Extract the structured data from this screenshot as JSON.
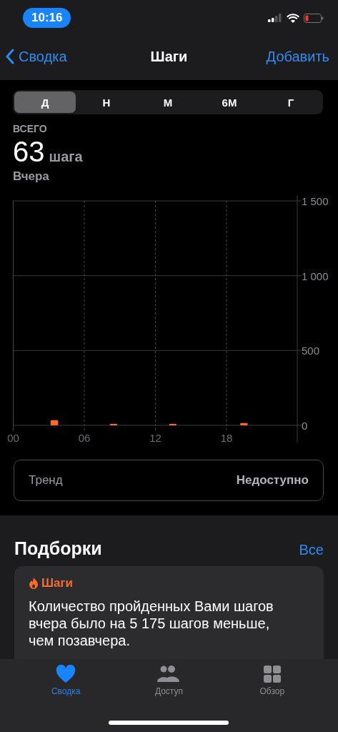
{
  "status_bar": {
    "time": "10:16"
  },
  "nav": {
    "back": "Сводка",
    "title": "Шаги",
    "action": "Добавить"
  },
  "segments": [
    {
      "label": "Д",
      "selected": true
    },
    {
      "label": "Н",
      "selected": false
    },
    {
      "label": "М",
      "selected": false
    },
    {
      "label": "6М",
      "selected": false
    },
    {
      "label": "Г",
      "selected": false
    }
  ],
  "summary": {
    "caption": "ВСЕГО",
    "value": "63",
    "unit": "шага",
    "date": "Вчера"
  },
  "chart_data": {
    "type": "bar",
    "x": [
      3.5,
      8.5,
      13.5,
      19.5
    ],
    "series": [
      {
        "color": "#ff6a2b",
        "values": [
          35,
          3,
          10,
          15
        ]
      }
    ],
    "xlim": [
      0,
      24
    ],
    "ylim": [
      0,
      1500
    ],
    "grid": true,
    "yticks": [
      {
        "value": 1500,
        "label": "1 500"
      },
      {
        "value": 1000,
        "label": "1 000"
      },
      {
        "value": 500,
        "label": "500"
      },
      {
        "value": 0,
        "label": "0"
      }
    ],
    "xticks": [
      {
        "value": 0,
        "label": "00"
      },
      {
        "value": 6,
        "label": "06"
      },
      {
        "value": 12,
        "label": "12"
      },
      {
        "value": 18,
        "label": "18"
      }
    ]
  },
  "trend": {
    "label": "Тренд",
    "value": "Недоступно"
  },
  "highlights": {
    "title": "Подборки",
    "link": "Все",
    "card": {
      "category": "Шаги",
      "text": "Количество пройденных Вами шагов вчера было на 5 175 шагов меньше, чем позавчера."
    }
  },
  "tab_bar": [
    {
      "label": "Сводка",
      "selected": true
    },
    {
      "label": "Доступ",
      "selected": false
    },
    {
      "label": "Обзор",
      "selected": false
    }
  ]
}
